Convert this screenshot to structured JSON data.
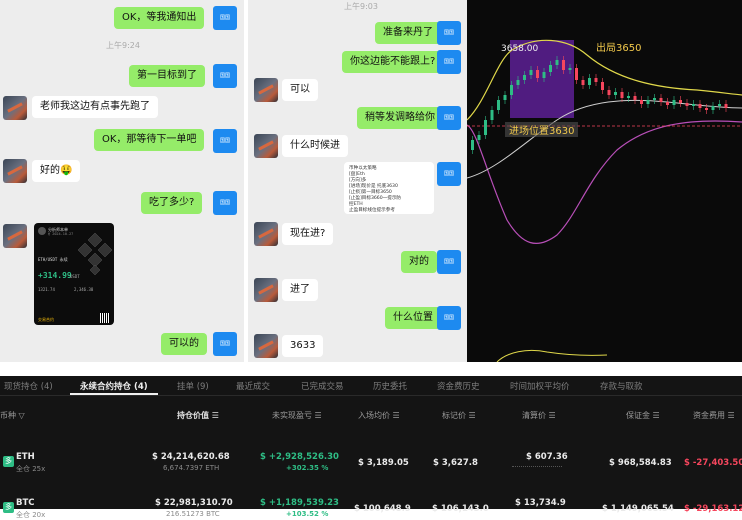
{
  "chat_a": {
    "messages": [
      {
        "side": "me",
        "text": "OK，等我通知出"
      },
      {
        "type": "time",
        "text": "上午9:24"
      },
      {
        "side": "me",
        "text": "第一目标到了"
      },
      {
        "side": "them",
        "text": "老师我这边有点事先跑了"
      },
      {
        "side": "me",
        "text": "OK，那等待下一单吧"
      },
      {
        "side": "them",
        "text": "好的🤑"
      },
      {
        "side": "me",
        "text": "吃了多少?"
      },
      {
        "side": "them",
        "type": "card"
      },
      {
        "side": "me",
        "text": "可以的"
      }
    ],
    "card": {
      "header_top": "分析师本单",
      "header_bottom": "@ 2024-10-27",
      "pair": "ETH/USDT 永续",
      "pnl": "+314.99",
      "pnl_unit": "USDT",
      "row1a": "1321.74",
      "row1b": "2,346.38",
      "footer": "交易合约"
    }
  },
  "chat_b": {
    "messages": [
      {
        "type": "time",
        "text": "上午9:03"
      },
      {
        "side": "me",
        "text": "准备来丹了"
      },
      {
        "side": "me",
        "text": "你这边能不能跟上?"
      },
      {
        "side": "them",
        "text": "可以"
      },
      {
        "side": "me",
        "text": "稍等发调略给你"
      },
      {
        "side": "them",
        "text": "什么时候进"
      },
      {
        "side": "me",
        "type": "doc"
      },
      {
        "side": "them",
        "text": "现在进?"
      },
      {
        "side": "me",
        "text": "对的"
      },
      {
        "side": "them",
        "text": "进了"
      },
      {
        "side": "me",
        "text": "什么位置"
      },
      {
        "side": "them",
        "text": "3633"
      }
    ],
    "doc_text": "币种以太策略\n[盘]Eth\n[方向]多\n[进场]现价是 托底3630\n[止损]第一目标3650\n[止盈]目标3660一提示防\n控ETH\n止盈目标线位提示参考"
  },
  "my_avatar_label": "国国",
  "chart": {
    "entry_label": "进场位置3630",
    "exit_label": "出局3650",
    "price_label": "3658.00",
    "colors": {
      "up": "#2ebd85",
      "down": "#f6465d",
      "upper_band": "#e0d84a",
      "lower_band": "#b84fb8",
      "mid": "#cfcfcf",
      "box": "#8a2be2",
      "label": "#f2c94c"
    }
  },
  "positions": {
    "tabs": [
      "现货持仓 (4)",
      "永续合约持仓 (4)",
      "挂单 (9)",
      "最近成交",
      "已完成交易",
      "历史委托",
      "资金费历史",
      "时间加权平均价",
      "存款与取款"
    ],
    "active_tab": 1,
    "headers": [
      "币种 ▽",
      "持仓价值 ☰",
      "未实现盈亏 ☰",
      "入场均价 ☰",
      "标记价 ☰",
      "清算价 ☰",
      "保证金 ☰",
      "资金费用 ☰"
    ],
    "rows": [
      {
        "tag": "多",
        "coin": "ETH",
        "leverage": "全仓 25x",
        "value": "$ 24,214,620.68",
        "size": "6,674.7397 ETH",
        "pnl": "$ +2,928,526.30",
        "pnl_pct": "+302.35 %",
        "entry": "$ 3,189.05",
        "mark": "$ 3,627.8",
        "liq": "$ 607.36",
        "margin": "$ 968,584.83",
        "funding": "$ -27,403.50"
      },
      {
        "tag": "多",
        "coin": "BTC",
        "leverage": "全仓 20x",
        "value": "$ 22,981,310.70",
        "size": "216.51273 BTC",
        "pnl": "$ +1,189,539.23",
        "pnl_pct": "+103.52 %",
        "entry": "$ 100,648.9",
        "mark": "$ 106,143.0",
        "liq": "$ 13,734.9",
        "margin": "$ 1,149,065.54",
        "funding": "$ -29,163.12"
      }
    ]
  }
}
